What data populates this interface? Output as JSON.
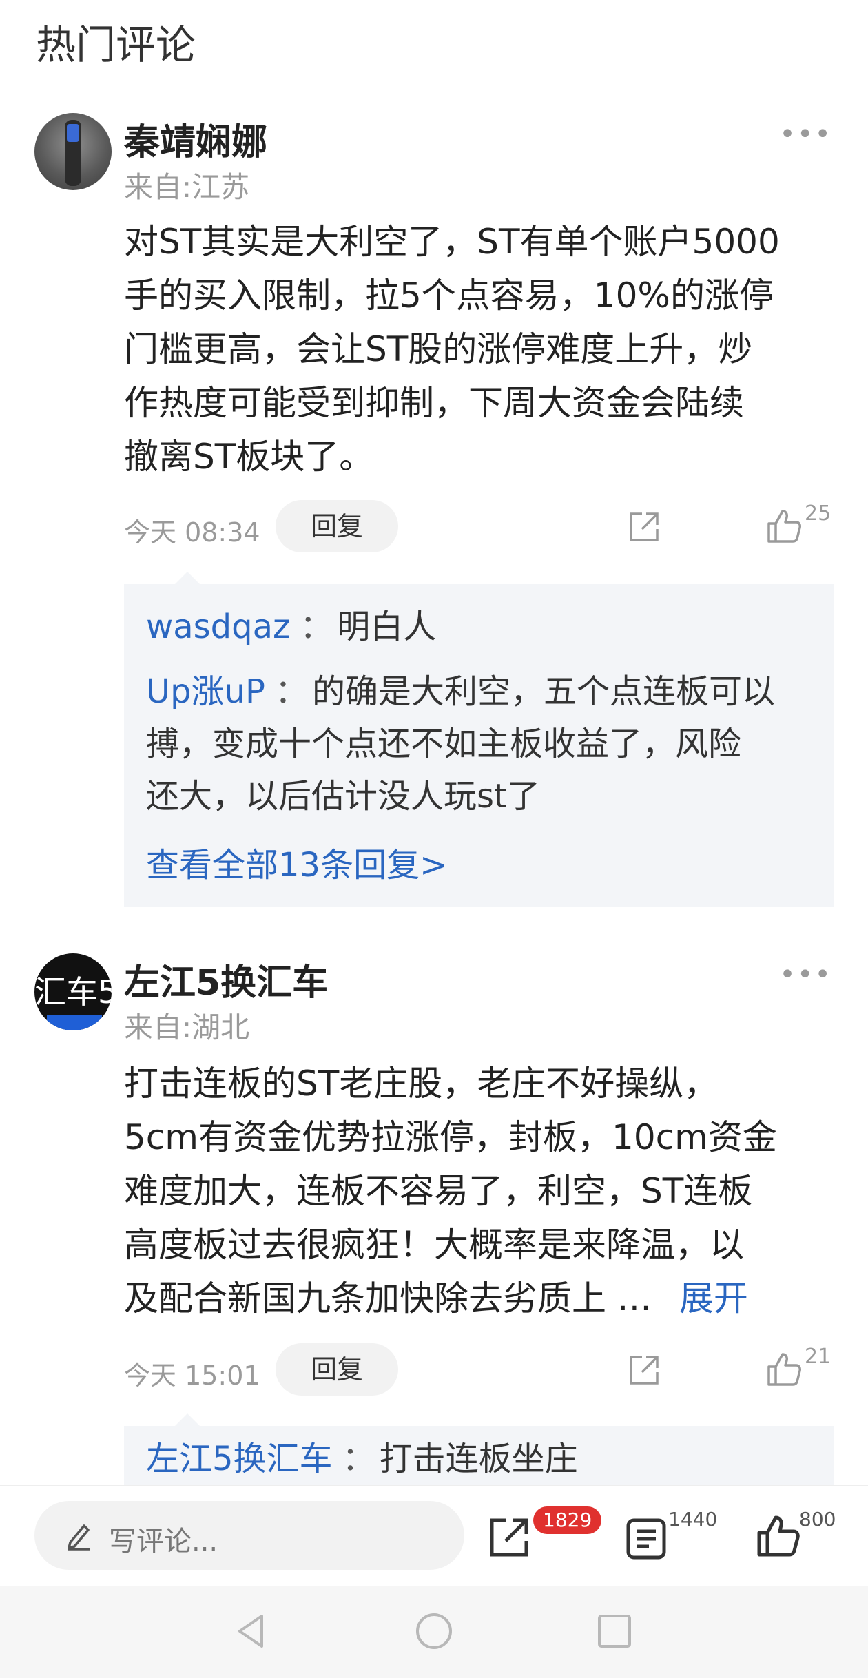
{
  "section_title": "热门评论",
  "comments": [
    {
      "username": "秦靖娴娜",
      "location": "来自:江苏",
      "content_lines": [
        "对ST其实是大利空了，ST有单个账户5000",
        "手的买入限制，拉5个点容易，10%的涨停",
        "门槛更高，会让ST股的涨停难度上升，炒",
        "作热度可能受到抑制，下周大资金会陆续",
        "撤离ST板块了。"
      ],
      "time": "今天 08:34",
      "reply_label": "回复",
      "like_count": "25",
      "replies": [
        {
          "name": "wasdqaz",
          "colon": "：",
          "lines": [
            "明白人"
          ]
        },
        {
          "name": "Up涨uP",
          "colon": "：",
          "lines": [
            "的确是大利空，五个点连板可以",
            "搏，变成十个点还不如主板收益了，风险",
            "还大，以后估计没人玩st了"
          ]
        }
      ],
      "see_all": "查看全部13条回复>"
    },
    {
      "username": "左江5换汇车",
      "location": "来自:湖北",
      "avatar_text": "汇车5",
      "content_lines": [
        "打击连板的ST老庄股，老庄不好操纵，",
        "5cm有资金优势拉涨停，封板，10cm资金",
        "难度加大，连板不容易了，利空，ST连板",
        "高度板过去很疯狂！大概率是来降温，以",
        "及配合新国九条加快除去劣质上"
      ],
      "ellipsis": "…",
      "expand_label": "展开",
      "time": "今天 15:01",
      "reply_label": "回复",
      "like_count": "21",
      "replies": [
        {
          "name": "左江5换汇车",
          "colon": "：",
          "lines": [
            "打击连板坐庄"
          ]
        }
      ]
    }
  ],
  "bottom_bar": {
    "input_placeholder": "写评论...",
    "share_badge": "1829",
    "comment_count": "1440",
    "like_count": "800"
  },
  "icons": {
    "more": "more-dots-icon",
    "share": "share-icon",
    "like": "thumbs-up-icon",
    "pencil": "pencil-icon",
    "comments": "comment-list-icon",
    "back": "nav-back-icon",
    "home": "nav-home-icon",
    "recent": "nav-recent-icon"
  },
  "colors": {
    "link": "#2a66c0",
    "badge": "#e0312f",
    "reply_bg": "#f3f5f8"
  }
}
